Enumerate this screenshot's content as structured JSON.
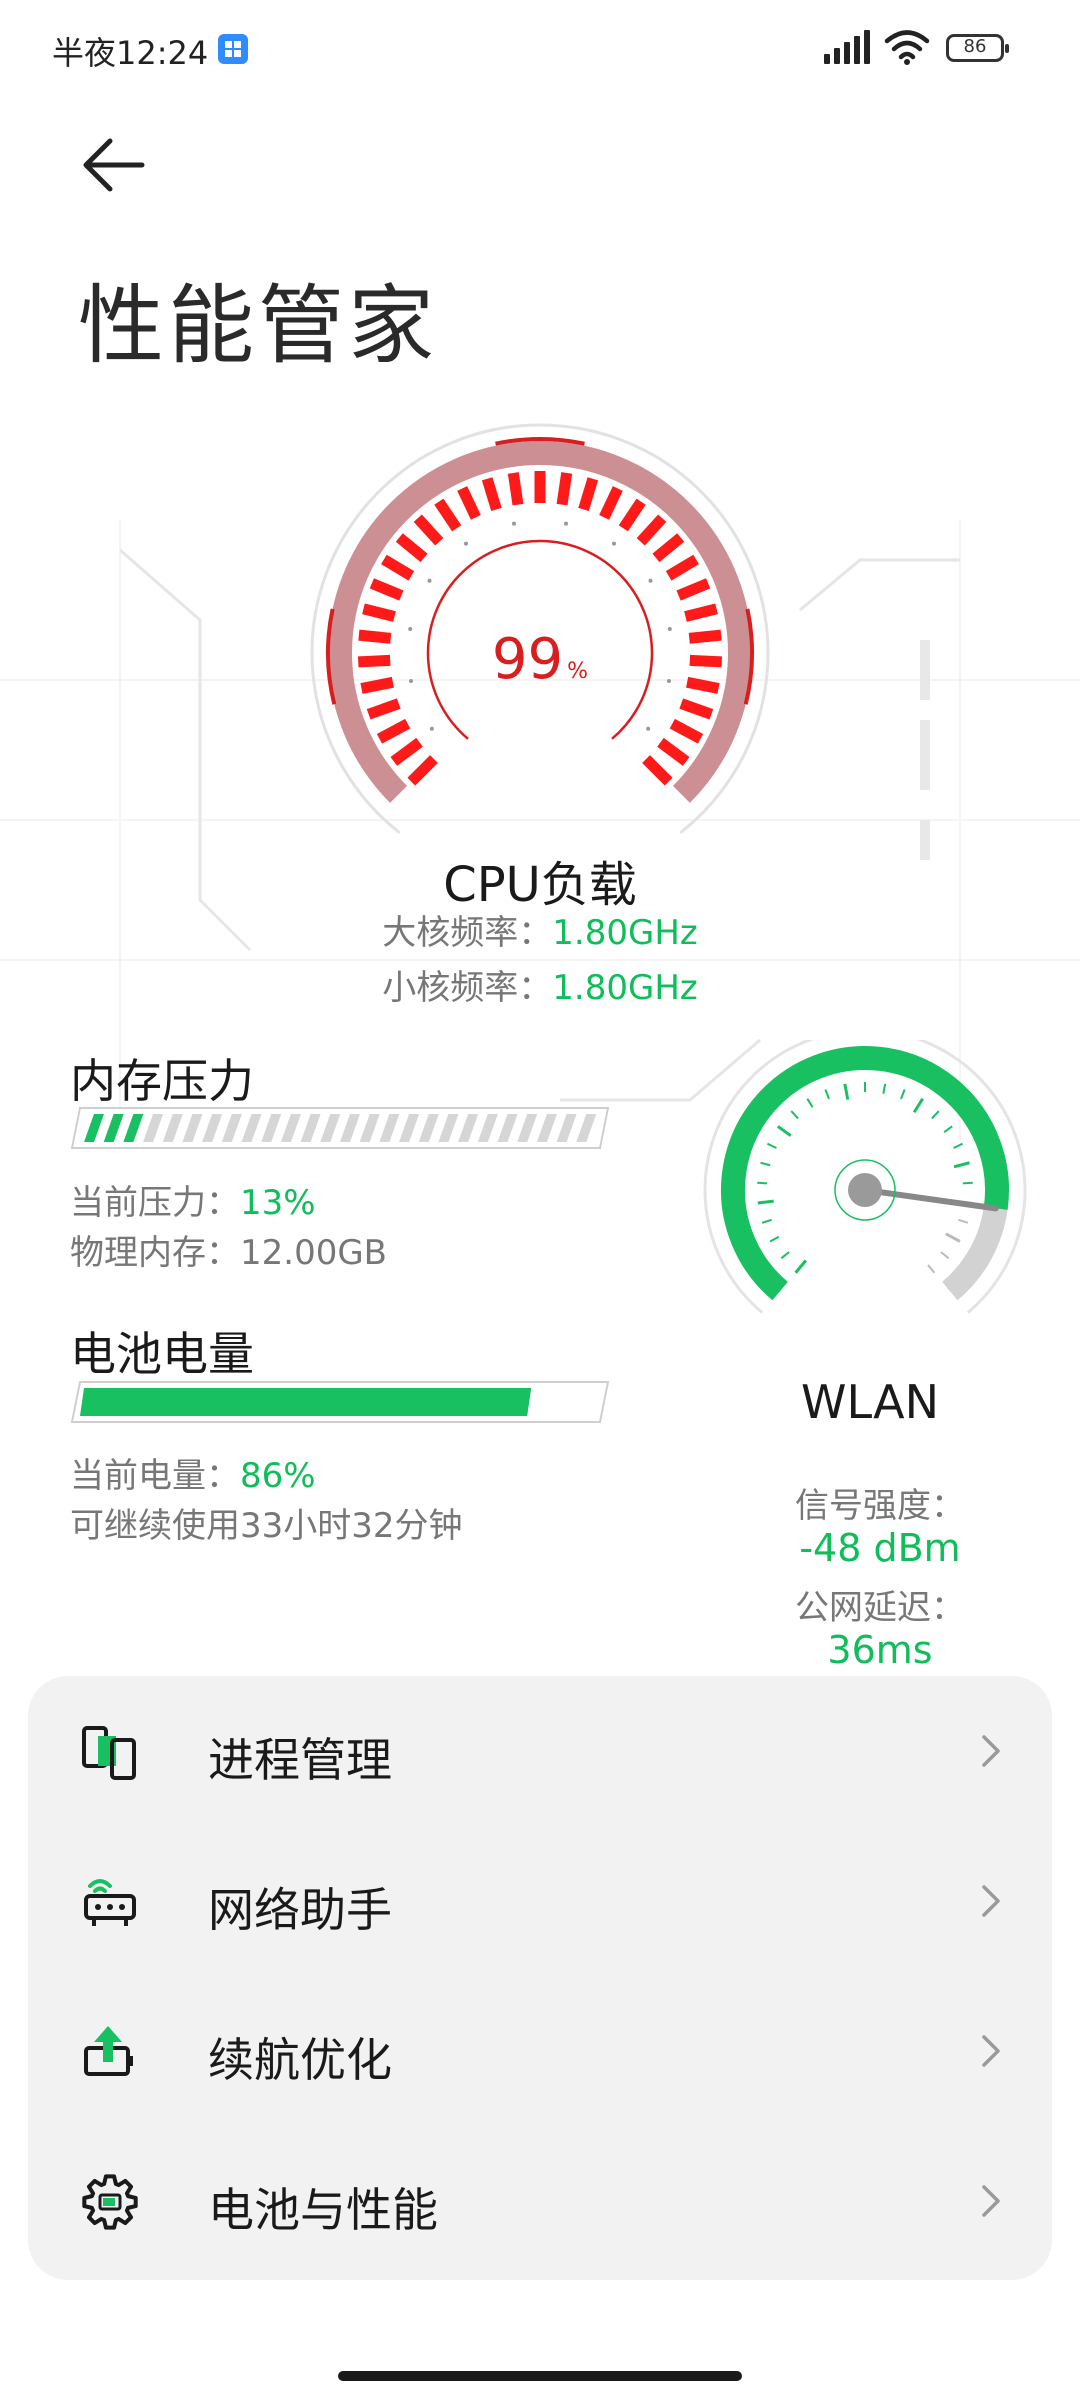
{
  "status_bar": {
    "time": "半夜12:24",
    "battery_level": "86",
    "icons": [
      "app-notification-icon",
      "signal-icon",
      "wifi-icon",
      "battery-icon"
    ]
  },
  "header": {
    "back_icon": "back-arrow-icon",
    "title": "性能管家"
  },
  "cpu": {
    "value": "99",
    "unit": "%",
    "load_fraction": 0.99,
    "title": "CPU负载",
    "big_core_label": "大核频率：",
    "big_core_value": "1.80GHz",
    "little_core_label": "小核频率：",
    "little_core_value": "1.80GHz",
    "color": "#d81e1e"
  },
  "memory": {
    "title": "内存压力",
    "pressure_label": "当前压力：",
    "pressure_value": "13%",
    "pressure_fraction": 0.13,
    "physical_label": "物理内存：",
    "physical_value": "12.00GB"
  },
  "battery": {
    "title": "电池电量",
    "level_label": "当前电量：",
    "level_value": "86%",
    "level_fraction": 0.86,
    "remaining": "可继续使用33小时32分钟"
  },
  "wlan": {
    "title": "WLAN",
    "signal_label": "信号强度：",
    "signal_value": "-48 dBm",
    "latency_label": "公网延迟：",
    "latency_value": "36ms",
    "gauge_fraction": 0.85
  },
  "menu": {
    "items": [
      {
        "label": "进程管理",
        "icon": "process-manager-icon"
      },
      {
        "label": "网络助手",
        "icon": "router-icon"
      },
      {
        "label": "续航优化",
        "icon": "battery-boost-icon"
      },
      {
        "label": "电池与性能",
        "icon": "gear-icon"
      }
    ]
  },
  "colors": {
    "accent_green": "#0fbe5a",
    "cpu_red": "#d81e1e",
    "card_bg": "#f2f2f2"
  }
}
